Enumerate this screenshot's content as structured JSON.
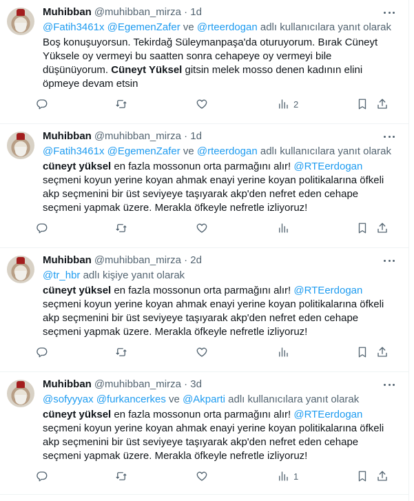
{
  "tweets": [
    {
      "name": "Muhibban",
      "handle": "@muhibban_mirza",
      "time": "1d",
      "reply_mentions": [
        "@Fatih3461x",
        "@EgemenZafer",
        "ve",
        "@rteerdogan"
      ],
      "reply_suffix": "adlı kullanıcılara yanıt olarak",
      "lines": [
        [
          {
            "t": "Boş konuşuyorsun. Tekirdağ Süleymanpaşa'da oturuyorum. Bırak Cüneyt"
          }
        ],
        [
          {
            "t": "Yüksele oy vermeyi bu saatten sonra cehapeye oy vermeyi bile"
          }
        ],
        [
          {
            "t": "düşünüyorum. "
          },
          {
            "t": "Cüneyt Yüksel",
            "b": true
          },
          {
            "t": " gitsin melek mosso denen kadının elini"
          }
        ],
        [
          {
            "t": "öpmeye devam etsin"
          }
        ]
      ],
      "views": "2"
    },
    {
      "name": "Muhibban",
      "handle": "@muhibban_mirza",
      "time": "1d",
      "reply_mentions": [
        "@Fatih3461x",
        "@EgemenZafer",
        "ve",
        "@rteerdogan"
      ],
      "reply_suffix": "adlı kullanıcılara yanıt olarak",
      "lines": [
        [
          {
            "t": "cüneyt yüksel",
            "b": true
          },
          {
            "t": " en fazla mossonun orta parmağını alır! "
          },
          {
            "t": "@RTEerdogan",
            "m": true
          }
        ],
        [
          {
            "t": "seçmeni koyun yerine koyan ahmak enayi yerine koyan politikalarına öfkeli"
          }
        ],
        [
          {
            "t": "akp seçmenini bir üst seviyeye taşıyarak akp'den nefret eden cehape"
          }
        ],
        [
          {
            "t": "seçmeni yapmak üzere. Merakla öfkeyle nefretle izliyoruz!"
          }
        ]
      ],
      "views": ""
    },
    {
      "name": "Muhibban",
      "handle": "@muhibban_mirza",
      "time": "2d",
      "reply_mentions": [
        "@tr_hbr"
      ],
      "reply_suffix": "adlı kişiye yanıt olarak",
      "lines": [
        [
          {
            "t": "cüneyt yüksel",
            "b": true
          },
          {
            "t": " en fazla mossonun orta parmağını alır! "
          },
          {
            "t": "@RTEerdogan",
            "m": true
          }
        ],
        [
          {
            "t": "seçmeni koyun yerine koyan ahmak enayi yerine koyan politikalarına öfkeli"
          }
        ],
        [
          {
            "t": "akp seçmenini bir üst seviyeye taşıyarak akp'den nefret eden cehape"
          }
        ],
        [
          {
            "t": "seçmeni yapmak üzere. Merakla öfkeyle nefretle izliyoruz!"
          }
        ]
      ],
      "views": ""
    },
    {
      "name": "Muhibban",
      "handle": "@muhibban_mirza",
      "time": "3d",
      "reply_mentions": [
        "@sofyyyax",
        "@furkancerkes",
        "ve",
        "@Akparti"
      ],
      "reply_suffix": "adlı kullanıcılara yanıt olarak",
      "lines": [
        [
          {
            "t": "cüneyt yüksel",
            "b": true
          },
          {
            "t": " en fazla mossonun orta parmağını alır! "
          },
          {
            "t": "@RTEerdogan",
            "m": true
          }
        ],
        [
          {
            "t": "seçmeni koyun yerine koyan ahmak enayi yerine koyan politikalarına öfkeli"
          }
        ],
        [
          {
            "t": "akp seçmenini bir üst seviyeye taşıyarak akp'den nefret eden cehape"
          }
        ],
        [
          {
            "t": "seçmeni yapmak üzere. Merakla öfkeyle nefretle izliyoruz!"
          }
        ]
      ],
      "views": "1"
    }
  ],
  "icons": {
    "reply": "reply-icon",
    "retweet": "retweet-icon",
    "like": "heart-icon",
    "views": "views-icon",
    "bookmark": "bookmark-icon",
    "share": "share-icon",
    "more": "more-icon"
  },
  "colors": {
    "link": "#1d9bf0",
    "muted": "#536471",
    "text": "#0f1419"
  }
}
